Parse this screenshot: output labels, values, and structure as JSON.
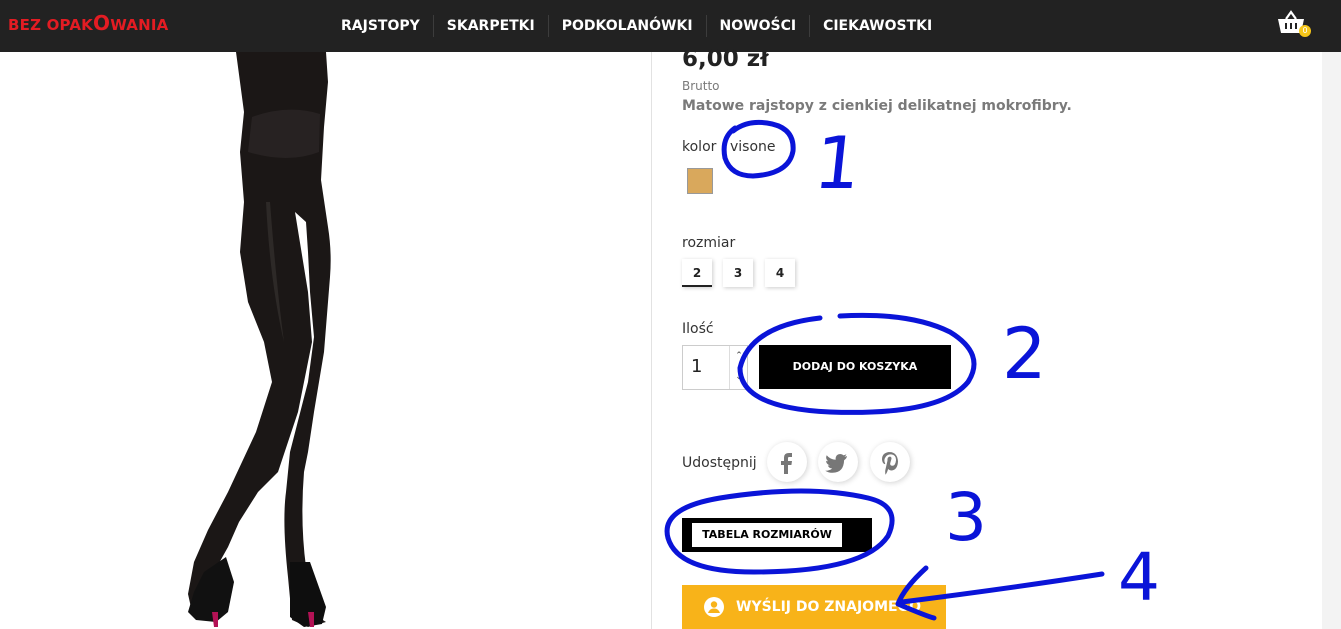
{
  "header": {
    "logo": {
      "part1": "BEZ OPAK",
      "big": "O",
      "part2": "WANIA"
    },
    "nav": [
      "RAJSTOPY",
      "SKARPETKI",
      "PODKOLANÓWKI",
      "NOWOŚCI",
      "CIEKAWOSTKI"
    ],
    "cart_count": "0"
  },
  "product": {
    "price": "6,00 zł",
    "tax_label": "Brutto",
    "description": "Matowe rajstopy z cienkiej delikatnej mokrofibry.",
    "color_label": "kolor : visone",
    "color_swatch": "#d9a85c",
    "size_label": "rozmiar",
    "sizes": [
      "2",
      "3",
      "4"
    ],
    "selected_size": "2",
    "quantity_label": "Ilość",
    "quantity": "1",
    "add_to_cart": "DODAJ DO KOSZYKA",
    "share_label": "Udostępnij",
    "share_icons": [
      "facebook-icon",
      "twitter-icon",
      "pinterest-icon"
    ],
    "size_table": "TABELA ROZMIARÓW",
    "send_to_friend": "WYŚLIJ DO ZNAJOMEGO"
  },
  "annotations": {
    "color": "#0a14d8",
    "numbers": [
      "1",
      "2",
      "3",
      "4"
    ]
  },
  "colors": {
    "topbar": "#222222",
    "logo": "#e31c23",
    "send_button": "#f8b319",
    "accent_badge": "#f5c518"
  }
}
